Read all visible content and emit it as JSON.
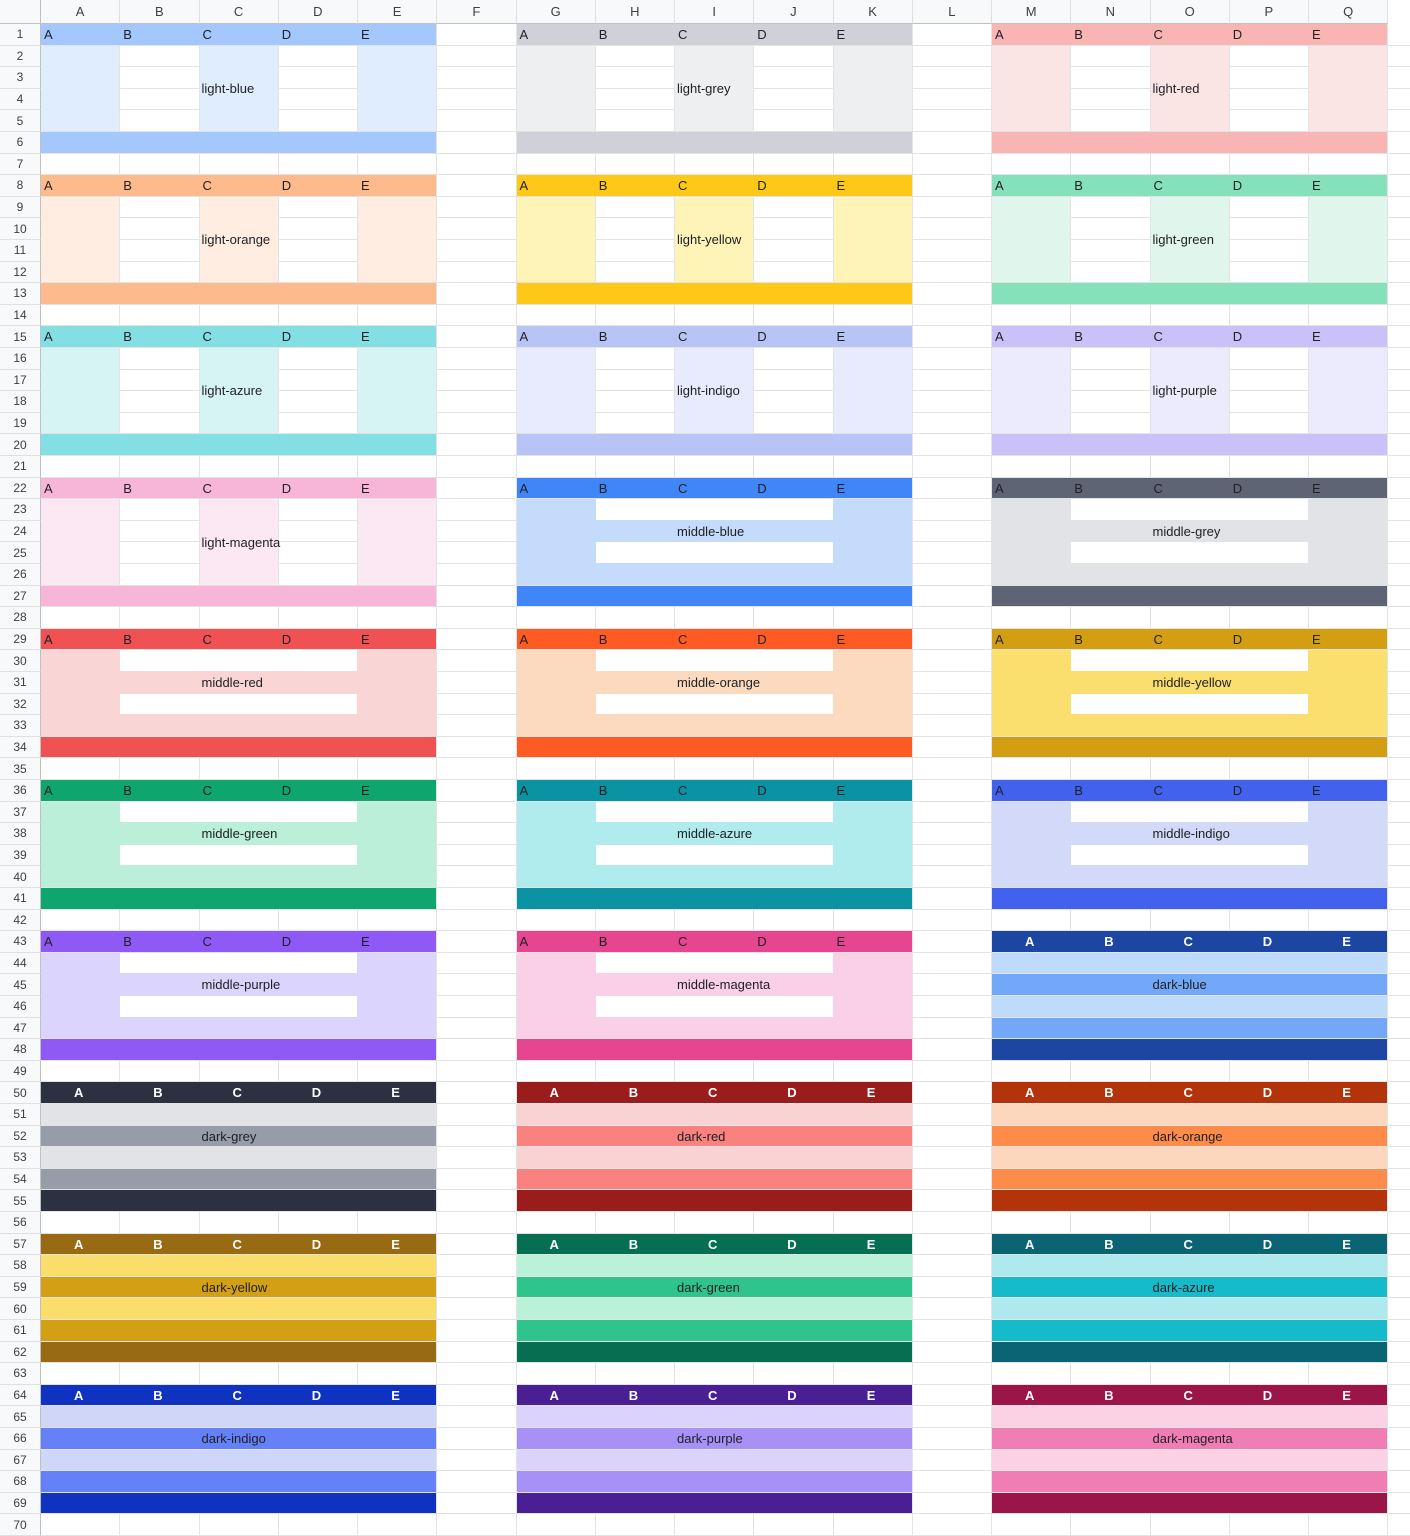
{
  "sheet": {
    "columns": [
      "A",
      "B",
      "C",
      "D",
      "E",
      "F",
      "G",
      "H",
      "I",
      "J",
      "K",
      "L",
      "M",
      "N",
      "O",
      "P",
      "Q"
    ],
    "rows": [
      "1",
      "2",
      "3",
      "4",
      "5",
      "6",
      "7",
      "8",
      "9",
      "10",
      "11",
      "12",
      "13",
      "14",
      "15",
      "16",
      "17",
      "18",
      "19",
      "20",
      "21",
      "22",
      "23",
      "24",
      "25",
      "26",
      "27",
      "28",
      "29",
      "30",
      "31",
      "32",
      "33",
      "34",
      "35",
      "36",
      "37",
      "38",
      "39",
      "40",
      "41",
      "42",
      "43",
      "44",
      "45",
      "46",
      "47",
      "48",
      "49",
      "50",
      "51",
      "52",
      "53",
      "54",
      "55",
      "56",
      "57",
      "58",
      "59",
      "60",
      "61",
      "62",
      "63",
      "64",
      "65",
      "66",
      "67",
      "68",
      "69",
      "70"
    ]
  },
  "block_header_letters": [
    "A",
    "B",
    "C",
    "D",
    "E"
  ],
  "blocks": [
    {
      "label": "light-blue",
      "style": "light",
      "c": [
        "#a4c7fd",
        "#e0edfe"
      ]
    },
    {
      "label": "light-grey",
      "style": "light",
      "c": [
        "#cfd0d8",
        "#eeeff1"
      ]
    },
    {
      "label": "light-red",
      "style": "light",
      "c": [
        "#f8b5b4",
        "#fbe5e4"
      ]
    },
    {
      "label": "light-orange",
      "style": "light",
      "c": [
        "#fdbb8d",
        "#feede0"
      ]
    },
    {
      "label": "light-yellow",
      "style": "light",
      "c": [
        "#fdc817",
        "#fef4b7"
      ]
    },
    {
      "label": "light-green",
      "style": "light",
      "c": [
        "#85e1b9",
        "#e0f6ed"
      ]
    },
    {
      "label": "light-azure",
      "style": "light",
      "c": [
        "#83dfe3",
        "#d7f4f5"
      ]
    },
    {
      "label": "light-indigo",
      "style": "light",
      "c": [
        "#b8c3f6",
        "#e8eafd"
      ]
    },
    {
      "label": "light-purple",
      "style": "light",
      "c": [
        "#cbc1f9",
        "#ecebfd"
      ]
    },
    {
      "label": "light-magenta",
      "style": "light",
      "c": [
        "#f7b5d8",
        "#fbe8f2"
      ]
    },
    {
      "label": "middle-blue",
      "style": "middle",
      "c": [
        "#4186f6",
        "#c4dbfc"
      ]
    },
    {
      "label": "middle-grey",
      "style": "middle",
      "c": [
        "#5f6475",
        "#e2e3e6"
      ]
    },
    {
      "label": "middle-red",
      "style": "middle",
      "c": [
        "#f05153",
        "#f9d5d5"
      ]
    },
    {
      "label": "middle-orange",
      "style": "middle",
      "c": [
        "#fe5a23",
        "#fcdabf"
      ]
    },
    {
      "label": "middle-yellow",
      "style": "middle",
      "c": [
        "#d49e13",
        "#fadf6e"
      ]
    },
    {
      "label": "middle-green",
      "style": "middle",
      "c": [
        "#0fa56e",
        "#bbefd9"
      ]
    },
    {
      "label": "middle-azure",
      "style": "middle",
      "c": [
        "#0b93a4",
        "#b0ebee"
      ]
    },
    {
      "label": "middle-indigo",
      "style": "middle",
      "c": [
        "#4262ee",
        "#d3d9f8"
      ]
    },
    {
      "label": "middle-purple",
      "style": "middle",
      "c": [
        "#8e59f4",
        "#dbd5fd"
      ]
    },
    {
      "label": "middle-magenta",
      "style": "middle",
      "c": [
        "#e6458f",
        "#f9d0e6"
      ]
    },
    {
      "label": "dark-blue",
      "style": "dark",
      "c": [
        "#1d46a3",
        "#bfdbfb",
        "#73a8f9"
      ]
    },
    {
      "label": "dark-grey",
      "style": "dark",
      "c": [
        "#2d3040",
        "#e2e3e6",
        "#979ca9"
      ]
    },
    {
      "label": "dark-red",
      "style": "dark",
      "c": [
        "#9b1c1d",
        "#f9d3d3",
        "#f9817f"
      ]
    },
    {
      "label": "dark-orange",
      "style": "dark",
      "c": [
        "#b3340b",
        "#fcd7bd",
        "#fd8b49"
      ]
    },
    {
      "label": "dark-yellow",
      "style": "dark",
      "c": [
        "#996a14",
        "#fbdd6b",
        "#d39f14"
      ]
    },
    {
      "label": "dark-green",
      "style": "dark",
      "c": [
        "#066f52",
        "#bbf0d9",
        "#2fc48d"
      ]
    },
    {
      "label": "dark-azure",
      "style": "dark",
      "c": [
        "#0b6473",
        "#aeeaed",
        "#15bbcb"
      ]
    },
    {
      "label": "dark-indigo",
      "style": "dark",
      "c": [
        "#0f33c0",
        "#cfd6f8",
        "#6581f7"
      ]
    },
    {
      "label": "dark-purple",
      "style": "dark",
      "c": [
        "#4a1f94",
        "#dcd3fd",
        "#a891f6"
      ]
    },
    {
      "label": "dark-magenta",
      "style": "dark",
      "c": [
        "#9c1549",
        "#fad2e4",
        "#f07eb5"
      ]
    }
  ]
}
